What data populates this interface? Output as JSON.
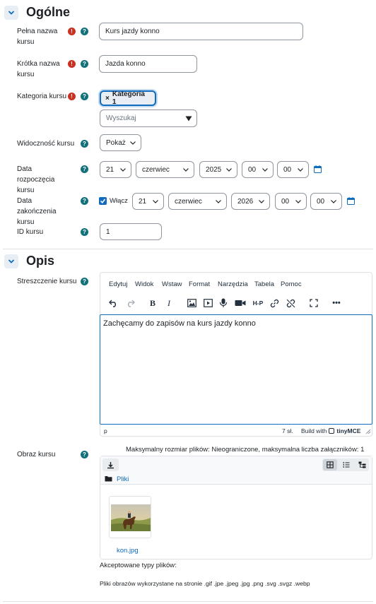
{
  "sections": {
    "general_title": "Ogólne",
    "description_title": "Opis"
  },
  "fields": {
    "fullname": {
      "label": "Pełna nazwa kursu",
      "value": "Kurs jazdy konno"
    },
    "shortname": {
      "label": "Krótka nazwa kursu",
      "value": "Jazda konno"
    },
    "category": {
      "label": "Kategoria kursu",
      "chip": "Kategoria 1",
      "chip_x": "×",
      "search": "Wyszukaj"
    },
    "visibility": {
      "label": "Widoczność kursu",
      "value": "Pokaż"
    },
    "startdate": {
      "label": "Data rozpoczęcia kursu",
      "day": "21",
      "month": "czerwiec",
      "year": "2025",
      "hour": "00",
      "minute": "00"
    },
    "enddate": {
      "label": "Data zakończenia kursu",
      "enable": "Włącz",
      "day": "21",
      "month": "czerwiec",
      "year": "2026",
      "hour": "00",
      "minute": "00"
    },
    "idnumber": {
      "label": "ID kursu",
      "value": "1"
    }
  },
  "summary": {
    "label": "Streszczenie kursu",
    "menu": [
      "Edytuj",
      "Widok",
      "Wstaw",
      "Format",
      "Narzędzia",
      "Tabela",
      "Pomoc"
    ],
    "content": "Zachęcamy do zapisów na kurs jazdy konno",
    "status_path": "p",
    "word_count": "7 sł.",
    "built_with": "Build with",
    "brand": "tinyMCE"
  },
  "image": {
    "label": "Obraz kursu",
    "max_info": "Maksymalny rozmiar plików: Nieograniczone, maksymalna liczba załączników: 1",
    "folder": "Pliki",
    "file_name": "kon.jpg",
    "accepted_title": "Akceptowane typy plików:",
    "accepted_types": "Pliki obrazów wykorzystane na stronie .gif .jpe .jpeg .jpg .png .svg .svgz .webp"
  },
  "icons": {
    "required": "!",
    "help": "?"
  },
  "colors": {
    "primary": "#0f6cbf",
    "required": "#ca3120",
    "help": "#11707a"
  }
}
